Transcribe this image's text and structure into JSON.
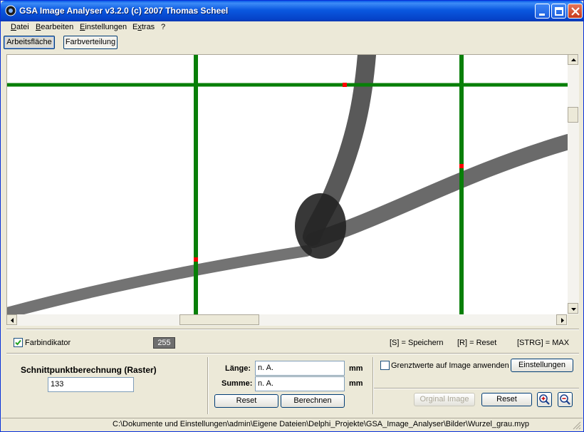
{
  "window": {
    "title": "GSA Image Analyser v3.2.0 (c) 2007   Thomas Scheel"
  },
  "menu": {
    "items": [
      {
        "label": "Datei",
        "underline": "D",
        "rest": "atei"
      },
      {
        "label": "Bearbeiten",
        "underline": "B",
        "rest": "earbeiten"
      },
      {
        "label": "Einstellungen",
        "underline": "E",
        "rest": "instellungen"
      },
      {
        "label": "Extras",
        "underline": "x",
        "prefix": "E",
        "rest": "tras"
      },
      {
        "label": "?",
        "underline": "",
        "rest": "?"
      }
    ]
  },
  "tabs": {
    "arbeitsflaeche": "Arbeitsfläche",
    "farbverteilung": "Farbverteilung"
  },
  "indicator": {
    "checkbox_label": "Farbindikator",
    "checked": true,
    "value": "255",
    "hint_save": "[S] = Speichern",
    "hint_reset": "[R] = Reset",
    "hint_max": "[STRG] = MAX"
  },
  "schnittpunkt": {
    "title": "Schnittpunktberechnung  (Raster)",
    "value": "133"
  },
  "measure": {
    "laenge_label": "Länge:",
    "laenge_value": "n. A.",
    "laenge_unit": "mm",
    "summe_label": "Summe:",
    "summe_value": "n. A.",
    "summe_unit": "mm",
    "reset_label": "Reset",
    "berechnen_label": "Berechnen"
  },
  "image_panel": {
    "grenzwerte_label": "Grenztwerte auf Image anwenden",
    "grenzwerte_checked": false,
    "einstellungen_label": "Einstellungen",
    "original_label": "Orginal Image",
    "reset_label": "Reset"
  },
  "status": {
    "path": "C:\\Dokumente und Einstellungen\\admin\\Eigene Dateien\\Delphi_Projekte\\GSA_Image_Analyser\\Bilder\\Wurzel_grau.myp"
  },
  "colors": {
    "grid": "#087f08",
    "intersection": "#ff0000",
    "root": "#555555"
  }
}
